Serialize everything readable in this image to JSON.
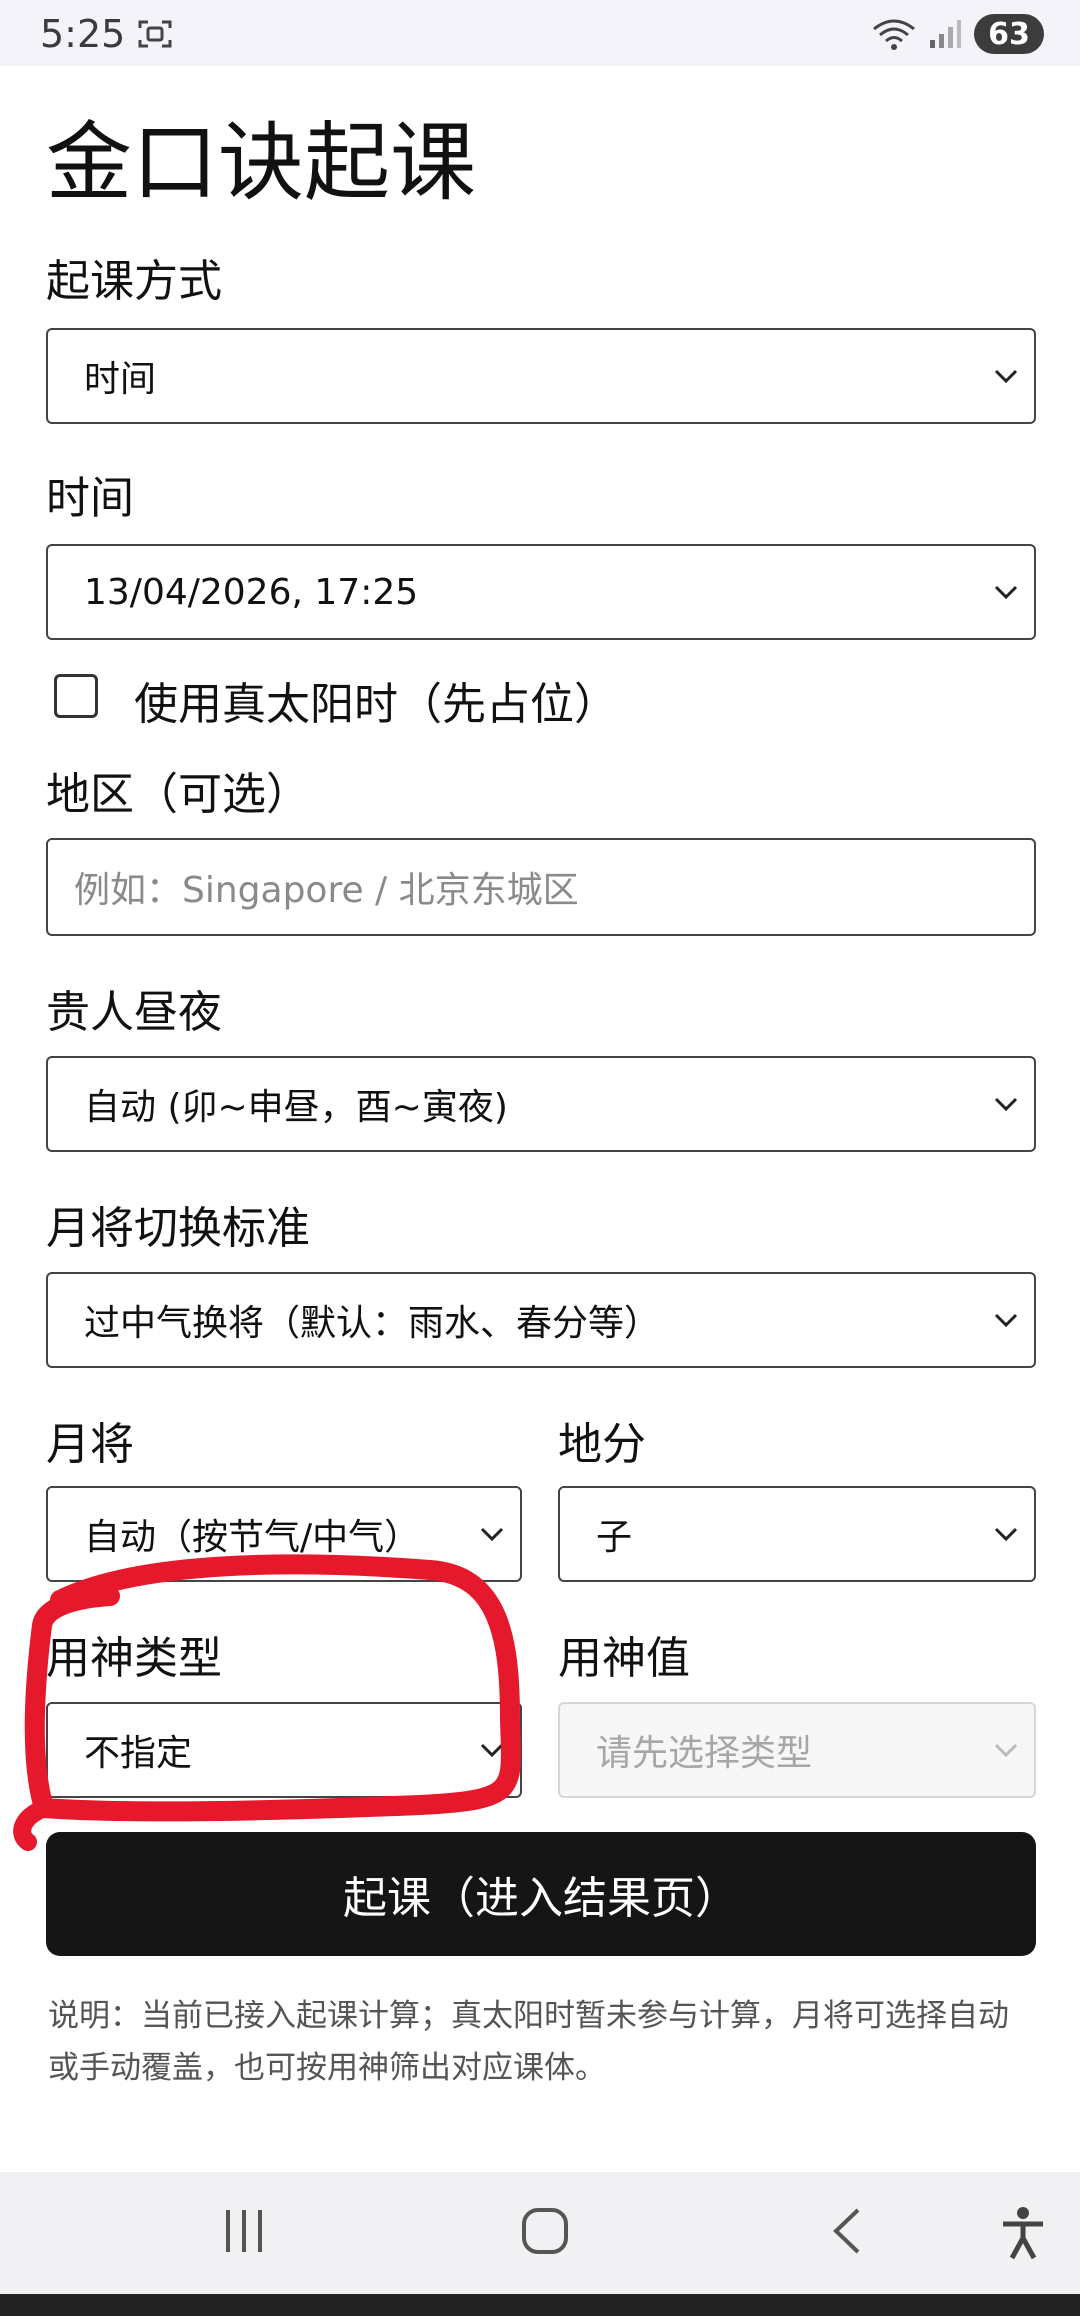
{
  "status_bar": {
    "time": "5:25",
    "battery": "63"
  },
  "page": {
    "title": "金口诀起课"
  },
  "form": {
    "method": {
      "label": "起课方式",
      "value": "时间"
    },
    "time": {
      "label": "时间",
      "value": "13/04/2026, 17:25"
    },
    "true_solar": {
      "label": "使用真太阳时（先占位）",
      "checked": false
    },
    "region": {
      "label": "地区（可选）",
      "placeholder": "例如：Singapore / 北京东城区"
    },
    "noble": {
      "label": "贵人昼夜",
      "value": "自动 (卯~申昼，酉~寅夜)"
    },
    "month_general_standard": {
      "label": "月将切换标准",
      "value": "过中气换将（默认：雨水、春分等）"
    },
    "month_general": {
      "label": "月将",
      "value": "自动（按节气/中气）"
    },
    "earth_branch": {
      "label": "地分",
      "value": "子"
    },
    "yongshen_type": {
      "label": "用神类型",
      "value": "不指定"
    },
    "yongshen_value": {
      "label": "用神值",
      "value": "请先选择类型"
    },
    "submit": {
      "label": "起课（进入结果页）"
    },
    "note": "说明：当前已接入起课计算；真太阳时暂未参与计算，月将可选择自动或手动覆盖，也可按用神筛出对应课体。"
  },
  "icons": {
    "status": [
      "screenshot-icon",
      "wifi-icon",
      "signal-icon",
      "battery-icon"
    ],
    "nav": [
      "recent-apps-icon",
      "home-icon",
      "back-icon",
      "accessibility-icon"
    ],
    "select": "chevron-down-icon"
  },
  "colors": {
    "annotation": "#e5192b",
    "button": "#151515"
  }
}
